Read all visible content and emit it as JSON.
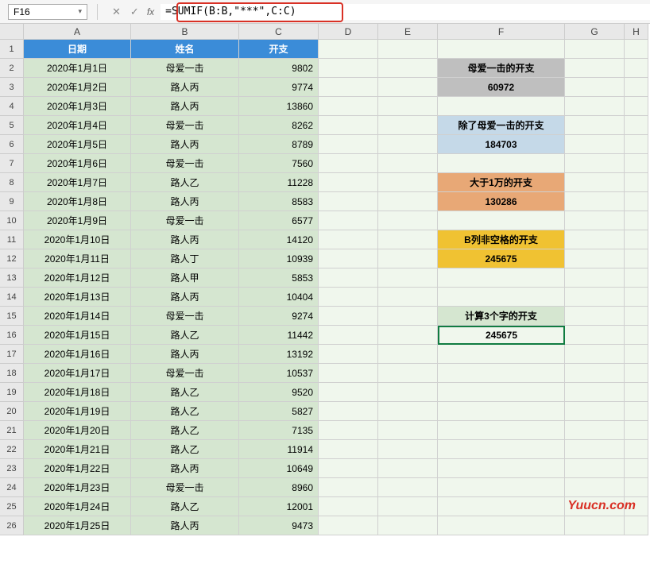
{
  "nameBox": "F16",
  "formula": "=SUMIF(B:B,\"***\",C:C)",
  "columns": [
    "A",
    "B",
    "C",
    "D",
    "E",
    "F",
    "G",
    "H"
  ],
  "headers": {
    "a": "日期",
    "b": "姓名",
    "c": "开支"
  },
  "rows": [
    {
      "n": "2",
      "a": "2020年1月1日",
      "b": "母爱一击",
      "c": "9802"
    },
    {
      "n": "3",
      "a": "2020年1月2日",
      "b": "路人丙",
      "c": "9774"
    },
    {
      "n": "4",
      "a": "2020年1月3日",
      "b": "路人丙",
      "c": "13860"
    },
    {
      "n": "5",
      "a": "2020年1月4日",
      "b": "母爱一击",
      "c": "8262"
    },
    {
      "n": "6",
      "a": "2020年1月5日",
      "b": "路人丙",
      "c": "8789"
    },
    {
      "n": "7",
      "a": "2020年1月6日",
      "b": "母爱一击",
      "c": "7560"
    },
    {
      "n": "8",
      "a": "2020年1月7日",
      "b": "路人乙",
      "c": "11228"
    },
    {
      "n": "9",
      "a": "2020年1月8日",
      "b": "路人丙",
      "c": "8583"
    },
    {
      "n": "10",
      "a": "2020年1月9日",
      "b": "母爱一击",
      "c": "6577"
    },
    {
      "n": "11",
      "a": "2020年1月10日",
      "b": "路人丙",
      "c": "14120"
    },
    {
      "n": "12",
      "a": "2020年1月11日",
      "b": "路人丁",
      "c": "10939"
    },
    {
      "n": "13",
      "a": "2020年1月12日",
      "b": "路人甲",
      "c": "5853"
    },
    {
      "n": "14",
      "a": "2020年1月13日",
      "b": "路人丙",
      "c": "10404"
    },
    {
      "n": "15",
      "a": "2020年1月14日",
      "b": "母爱一击",
      "c": "9274"
    },
    {
      "n": "16",
      "a": "2020年1月15日",
      "b": "路人乙",
      "c": "11442"
    },
    {
      "n": "17",
      "a": "2020年1月16日",
      "b": "路人丙",
      "c": "13192"
    },
    {
      "n": "18",
      "a": "2020年1月17日",
      "b": "母爱一击",
      "c": "10537"
    },
    {
      "n": "19",
      "a": "2020年1月18日",
      "b": "路人乙",
      "c": "9520"
    },
    {
      "n": "20",
      "a": "2020年1月19日",
      "b": "路人乙",
      "c": "5827"
    },
    {
      "n": "21",
      "a": "2020年1月20日",
      "b": "路人乙",
      "c": "7135"
    },
    {
      "n": "22",
      "a": "2020年1月21日",
      "b": "路人乙",
      "c": "11914"
    },
    {
      "n": "23",
      "a": "2020年1月22日",
      "b": "路人丙",
      "c": "10649"
    },
    {
      "n": "24",
      "a": "2020年1月23日",
      "b": "母爱一击",
      "c": "8960"
    },
    {
      "n": "25",
      "a": "2020年1月24日",
      "b": "路人乙",
      "c": "12001"
    },
    {
      "n": "26",
      "a": "2020年1月25日",
      "b": "路人丙",
      "c": "9473"
    }
  ],
  "summary": {
    "s1": {
      "title": "母爱一击的开支",
      "value": "60972",
      "row1": "2",
      "row2": "3"
    },
    "s2": {
      "title": "除了母爱一击的开支",
      "value": "184703",
      "row1": "5",
      "row2": "6"
    },
    "s3": {
      "title": "大于1万的开支",
      "value": "130286",
      "row1": "8",
      "row2": "9"
    },
    "s4": {
      "title": "B列非空格的开支",
      "value": "245675",
      "row1": "11",
      "row2": "12"
    },
    "s5": {
      "title": "计算3个字的开支",
      "value": "245675",
      "row1": "15",
      "row2": "16"
    }
  },
  "watermark": "Yuucn.com"
}
